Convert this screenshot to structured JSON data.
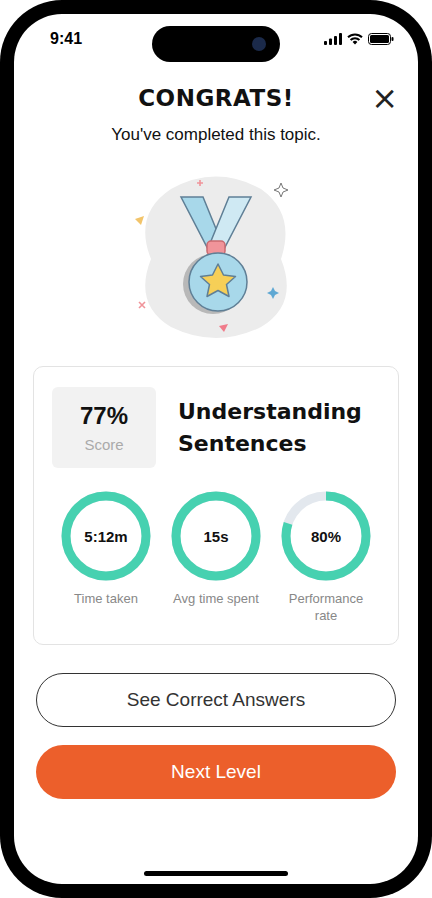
{
  "status_bar": {
    "time": "9:41"
  },
  "header": {
    "title": "CONGRATS!",
    "close": "×",
    "subtitle": "You've completed this topic."
  },
  "result": {
    "score": "77%",
    "score_label": "Score",
    "topic": "Understanding Sentences"
  },
  "stats": [
    {
      "value": "5:12m",
      "label": "Time taken",
      "level": 1
    },
    {
      "value": "15s",
      "label": "Avg time spent",
      "level": 1
    },
    {
      "value": "80%",
      "label": "Performance rate",
      "level": 0.8
    }
  ],
  "buttons": [
    {
      "label": "See Correct Answers",
      "kind": "outline"
    },
    {
      "label": "Next Level",
      "kind": "primary"
    }
  ]
}
